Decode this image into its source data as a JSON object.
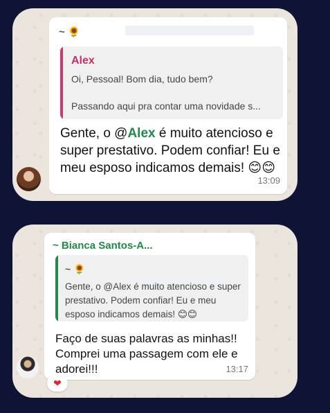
{
  "card1": {
    "sender": "~ 🌻",
    "quote": {
      "author": "Alex",
      "line1": "Oi, Pessoal! Bom dia, tudo bem?",
      "line2": "Passando aqui pra contar uma novidade s..."
    },
    "message_prefix": "Gente, o @",
    "mention": "Alex",
    "message_rest": " é muito atencioso e super prestativo. Podem confiar! Eu e meu esposo indicamos demais! 😊😊",
    "time": "13:09"
  },
  "card2": {
    "sender": "~ Bianca Santos-A...",
    "quote": {
      "sender": "~ 🌻",
      "text": "Gente, o @Alex é muito atencioso e super prestativo. Podem confiar! Eu e meu esposo indicamos demais! 😊😊"
    },
    "message": "Faço de suas palavras as minhas!! Comprei uma passagem com ele e adorei!!!",
    "time": "13:17",
    "reaction": "❤"
  },
  "colors": {
    "background": "#0f1436",
    "quote_bar_1": "#d4356e",
    "quote_bar_2": "#1f8a4c",
    "mention": "#1e8a4a"
  }
}
